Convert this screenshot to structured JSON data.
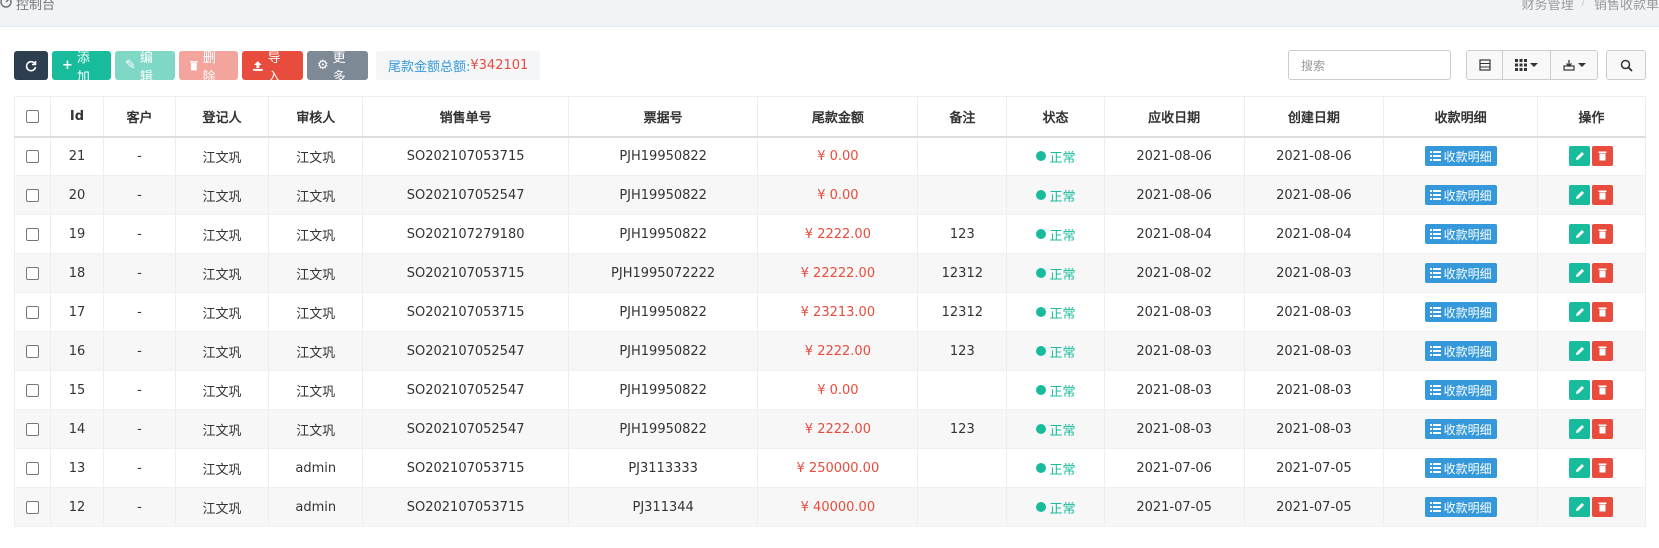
{
  "header": {
    "console_label": "控制台",
    "breadcrumb": [
      "财务管理",
      "销售收款单"
    ]
  },
  "toolbar": {
    "add_label": "添加",
    "edit_label": "编辑",
    "delete_label": "删除",
    "import_label": "导入",
    "more_label": "更多",
    "total_label": "尾款金额总额:",
    "total_value": "¥342101"
  },
  "search": {
    "placeholder": "搜索"
  },
  "table": {
    "columns": [
      "Id",
      "客户",
      "登记人",
      "审核人",
      "销售单号",
      "票据号",
      "尾款金额",
      "备注",
      "状态",
      "应收日期",
      "创建日期",
      "收款明细",
      "操作"
    ],
    "detail_label": "收款明细",
    "rows": [
      {
        "id": "21",
        "customer": "-",
        "registrar": "江文巩",
        "auditor": "江文巩",
        "order_no": "SO202107053715",
        "bill_no": "PJH19950822",
        "amount": "¥ 0.00",
        "note": "",
        "status": "正常",
        "due_date": "2021-08-06",
        "created": "2021-08-06"
      },
      {
        "id": "20",
        "customer": "-",
        "registrar": "江文巩",
        "auditor": "江文巩",
        "order_no": "SO202107052547",
        "bill_no": "PJH19950822",
        "amount": "¥ 0.00",
        "note": "",
        "status": "正常",
        "due_date": "2021-08-06",
        "created": "2021-08-06"
      },
      {
        "id": "19",
        "customer": "-",
        "registrar": "江文巩",
        "auditor": "江文巩",
        "order_no": "SO202107279180",
        "bill_no": "PJH19950822",
        "amount": "¥ 2222.00",
        "note": "123",
        "status": "正常",
        "due_date": "2021-08-04",
        "created": "2021-08-04"
      },
      {
        "id": "18",
        "customer": "-",
        "registrar": "江文巩",
        "auditor": "江文巩",
        "order_no": "SO202107053715",
        "bill_no": "PJH1995072222",
        "amount": "¥ 22222.00",
        "note": "12312",
        "status": "正常",
        "due_date": "2021-08-02",
        "created": "2021-08-03"
      },
      {
        "id": "17",
        "customer": "-",
        "registrar": "江文巩",
        "auditor": "江文巩",
        "order_no": "SO202107053715",
        "bill_no": "PJH19950822",
        "amount": "¥ 23213.00",
        "note": "12312",
        "status": "正常",
        "due_date": "2021-08-03",
        "created": "2021-08-03"
      },
      {
        "id": "16",
        "customer": "-",
        "registrar": "江文巩",
        "auditor": "江文巩",
        "order_no": "SO202107052547",
        "bill_no": "PJH19950822",
        "amount": "¥ 2222.00",
        "note": "123",
        "status": "正常",
        "due_date": "2021-08-03",
        "created": "2021-08-03"
      },
      {
        "id": "15",
        "customer": "-",
        "registrar": "江文巩",
        "auditor": "江文巩",
        "order_no": "SO202107052547",
        "bill_no": "PJH19950822",
        "amount": "¥ 0.00",
        "note": "",
        "status": "正常",
        "due_date": "2021-08-03",
        "created": "2021-08-03"
      },
      {
        "id": "14",
        "customer": "-",
        "registrar": "江文巩",
        "auditor": "江文巩",
        "order_no": "SO202107052547",
        "bill_no": "PJH19950822",
        "amount": "¥ 2222.00",
        "note": "123",
        "status": "正常",
        "due_date": "2021-08-03",
        "created": "2021-08-03"
      },
      {
        "id": "13",
        "customer": "-",
        "registrar": "江文巩",
        "auditor": "admin",
        "order_no": "SO202107053715",
        "bill_no": "PJ3113333",
        "amount": "¥ 250000.00",
        "note": "",
        "status": "正常",
        "due_date": "2021-07-06",
        "created": "2021-07-05"
      },
      {
        "id": "12",
        "customer": "-",
        "registrar": "江文巩",
        "auditor": "admin",
        "order_no": "SO202107053715",
        "bill_no": "PJ311344",
        "amount": "¥ 40000.00",
        "note": "",
        "status": "正常",
        "due_date": "2021-07-05",
        "created": "2021-07-05"
      }
    ]
  },
  "colors": {
    "primary": "#18bc9c",
    "danger": "#e74c3c",
    "info": "#3498db",
    "dark": "#2c3e50"
  }
}
